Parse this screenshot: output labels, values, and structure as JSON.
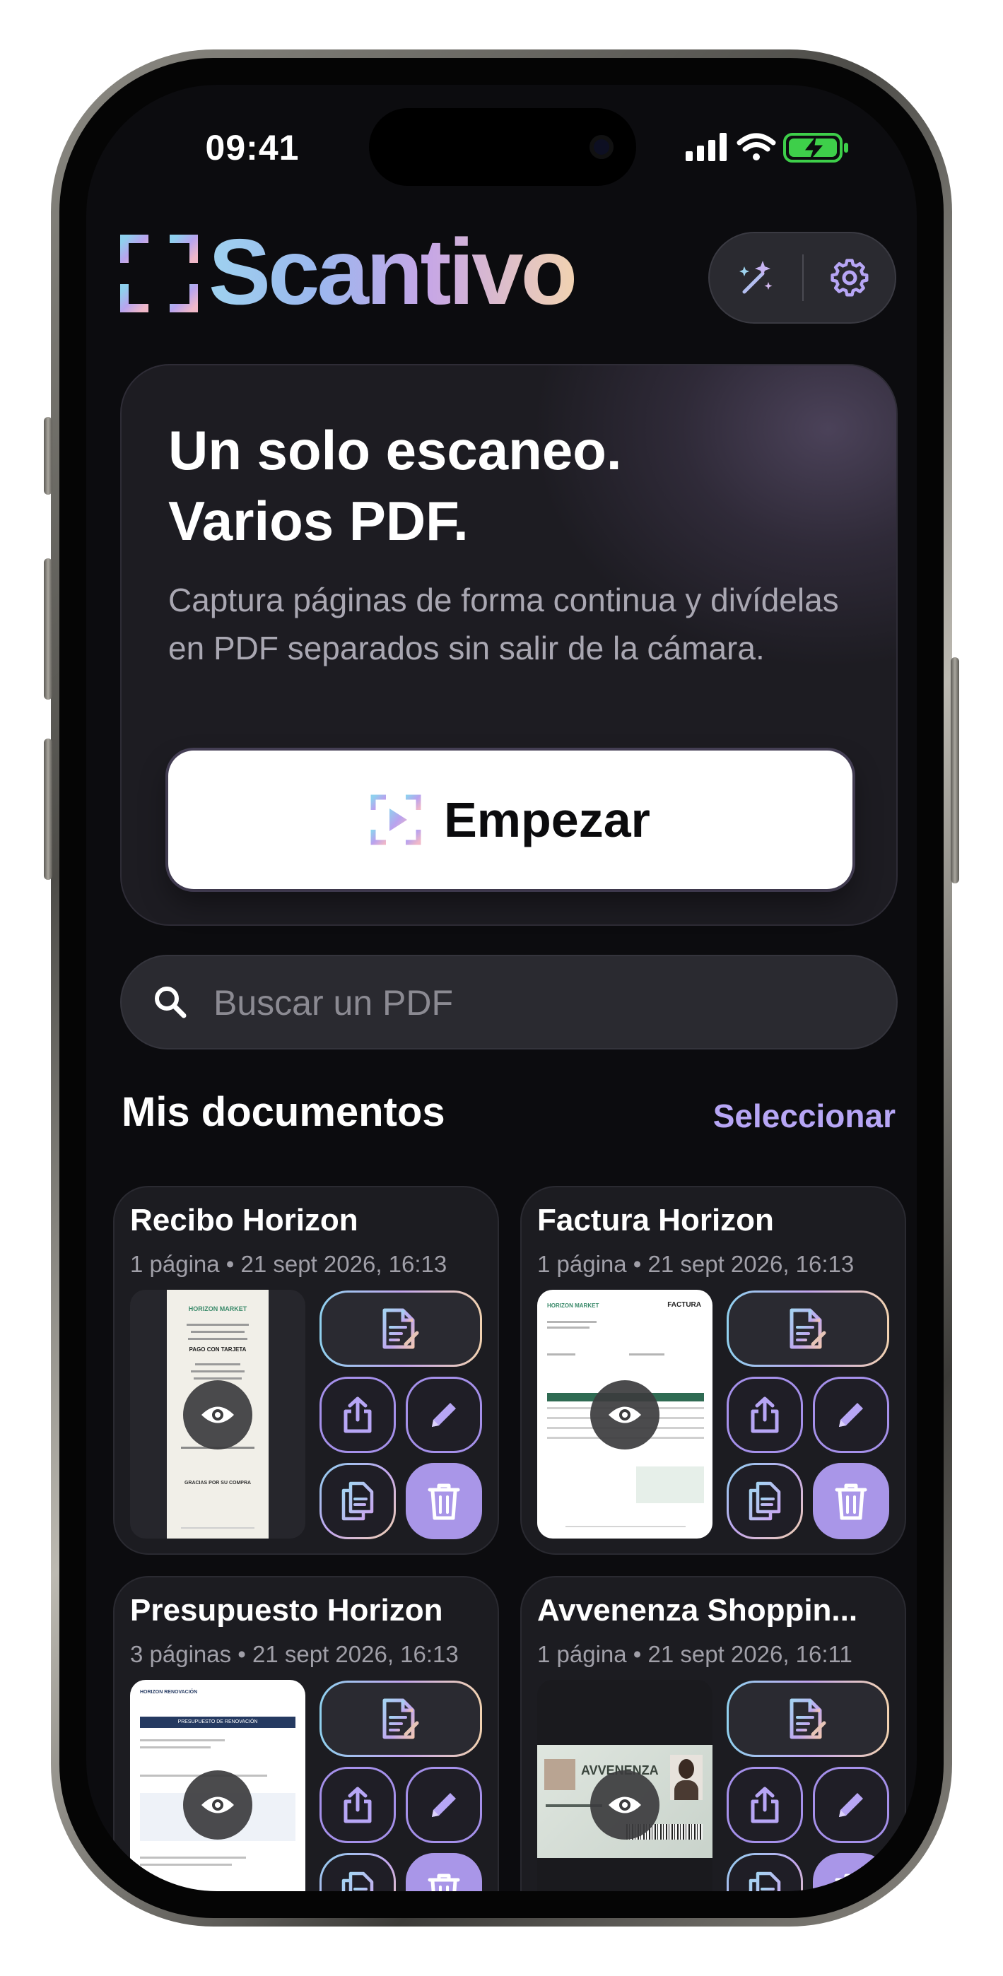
{
  "status_bar": {
    "time": "09:41"
  },
  "header": {
    "app_name": "Scantivo",
    "magic_button": "magic-wand",
    "settings_button": "settings"
  },
  "hero": {
    "title_line1": "Un solo escaneo.",
    "title_line2": "Varios PDF.",
    "subtitle": "Captura páginas de forma continua y divídelas en PDF separados sin salir de la cámara.",
    "cta_label": "Empezar"
  },
  "search": {
    "placeholder": "Buscar un PDF"
  },
  "documents": {
    "section_title": "Mis documentos",
    "select_label": "Seleccionar",
    "items": [
      {
        "title": "Recibo Horizon",
        "meta": "1 página • 21 sept 2026, 16:13",
        "thumb": "receipt"
      },
      {
        "title": "Factura Horizon",
        "meta": "1 página • 21 sept 2026, 16:13",
        "thumb": "invoice"
      },
      {
        "title": "Presupuesto Horizon",
        "meta": "3 páginas • 21 sept 2026, 16:13",
        "thumb": "quote"
      },
      {
        "title": "Avvenenza Shoppin...",
        "meta": "1 página • 21 sept 2026, 16:11",
        "thumb": "card"
      }
    ]
  },
  "receipt_thumb": {
    "header": "HORIZON MARKET",
    "line": "PAGO CON TARJETA",
    "footer": "GRACIAS POR SU COMPRA"
  },
  "invoice_thumb": {
    "header": "HORIZON MARKET",
    "label": "FACTURA"
  },
  "quote_thumb": {
    "header": "HORIZON RENOVACIÓN",
    "banner": "PRESUPUESTO DE RENOVACIÓN"
  },
  "card_thumb": {
    "brand": "AVVENENZA"
  },
  "colors": {
    "background": "#0c0c0f",
    "accent": "#b7a6f5",
    "delete": "#a996e8",
    "card": "#1c1c21"
  }
}
